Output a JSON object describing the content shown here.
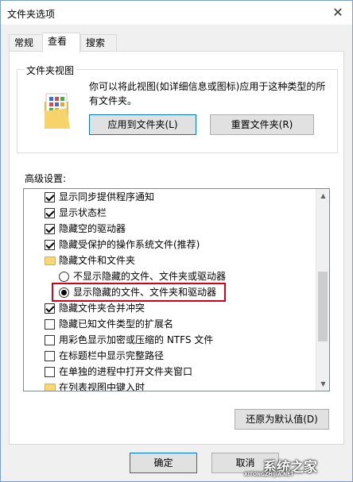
{
  "window": {
    "title": "文件夹选项",
    "close_glyph": "✕"
  },
  "tabs": [
    {
      "label": "常规"
    },
    {
      "label": "查看"
    },
    {
      "label": "搜索"
    }
  ],
  "folder_views": {
    "legend": "文件夹视图",
    "description": "你可以将此视图(如详细信息或图标)应用于这种类型的所有文件夹。",
    "apply_button": "应用到文件夹(L)",
    "reset_button": "重置文件夹(R)"
  },
  "advanced": {
    "label": "高级设置:",
    "items": [
      {
        "type": "checkbox",
        "checked": true,
        "label": "显示同步提供程序通知"
      },
      {
        "type": "checkbox",
        "checked": true,
        "label": "显示状态栏"
      },
      {
        "type": "checkbox",
        "checked": true,
        "label": "隐藏空的驱动器"
      },
      {
        "type": "checkbox",
        "checked": true,
        "label": "隐藏受保护的操作系统文件(推荐)"
      },
      {
        "type": "folder",
        "label": "隐藏文件和文件夹"
      },
      {
        "type": "radio",
        "checked": false,
        "label": "不显示隐藏的文件、文件夹或驱动器"
      },
      {
        "type": "radio",
        "checked": true,
        "label": "显示隐藏的文件、文件夹和驱动器"
      },
      {
        "type": "checkbox",
        "checked": true,
        "label": "隐藏文件夹合并冲突"
      },
      {
        "type": "checkbox",
        "checked": false,
        "label": "隐藏已知文件类型的扩展名"
      },
      {
        "type": "checkbox",
        "checked": false,
        "label": "用彩色显示加密或压缩的 NTFS 文件"
      },
      {
        "type": "checkbox",
        "checked": false,
        "label": "在标题栏中显示完整路径"
      },
      {
        "type": "checkbox",
        "checked": false,
        "label": "在单独的进程中打开文件夹窗口"
      },
      {
        "type": "folder",
        "label": "在列表视图中键入时"
      }
    ],
    "restore_button": "还原为默认值(D)"
  },
  "footer": {
    "ok_button": "确定",
    "cancel_button": "取消"
  },
  "watermark": {
    "text": "系统之家",
    "sub": "XITONGZHIJIA.NET"
  },
  "colors": {
    "highlight": "#d0021b",
    "accent": "#0078d7"
  }
}
